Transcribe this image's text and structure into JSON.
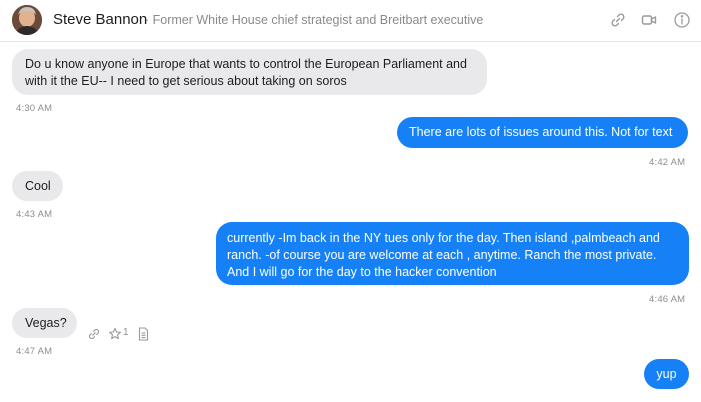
{
  "contact": {
    "name": "Steve Bannon",
    "subtitle": "· Former White House chief strategist and Breitbart executive"
  },
  "header_icons": [
    "link-icon",
    "video-icon",
    "info-icon"
  ],
  "messages": [
    {
      "direction": "incoming",
      "text": "Do u know anyone in Europe that wants to control the European Parliament and\nwith it the EU-- I need to get serious about taking on soros",
      "time": "4:30 AM"
    },
    {
      "direction": "outgoing",
      "text": "There are lots of issues around this. Not for text",
      "time": "4:42 AM"
    },
    {
      "direction": "incoming",
      "text": "Cool",
      "time": "4:43 AM"
    },
    {
      "direction": "outgoing",
      "text": "currently -Im back in the NY tues only for the day. Then island ,palmbeach and\nranch. -of course you are welcome at each , anytime. Ranch the most private.\nAnd I will go for the day to the hacker convention",
      "time": "4:46 AM"
    },
    {
      "direction": "incoming",
      "text": "Vegas?",
      "time": "4:47 AM",
      "reactions": {
        "icons": [
          "link-icon",
          "star-icon",
          "document-icon"
        ],
        "star_count": "1"
      }
    },
    {
      "direction": "outgoing",
      "text": "yup"
    }
  ],
  "colors": {
    "outgoing_bubble": "#1681f7",
    "incoming_bubble": "#e9e9eb",
    "timestamp": "#8e8e93"
  }
}
